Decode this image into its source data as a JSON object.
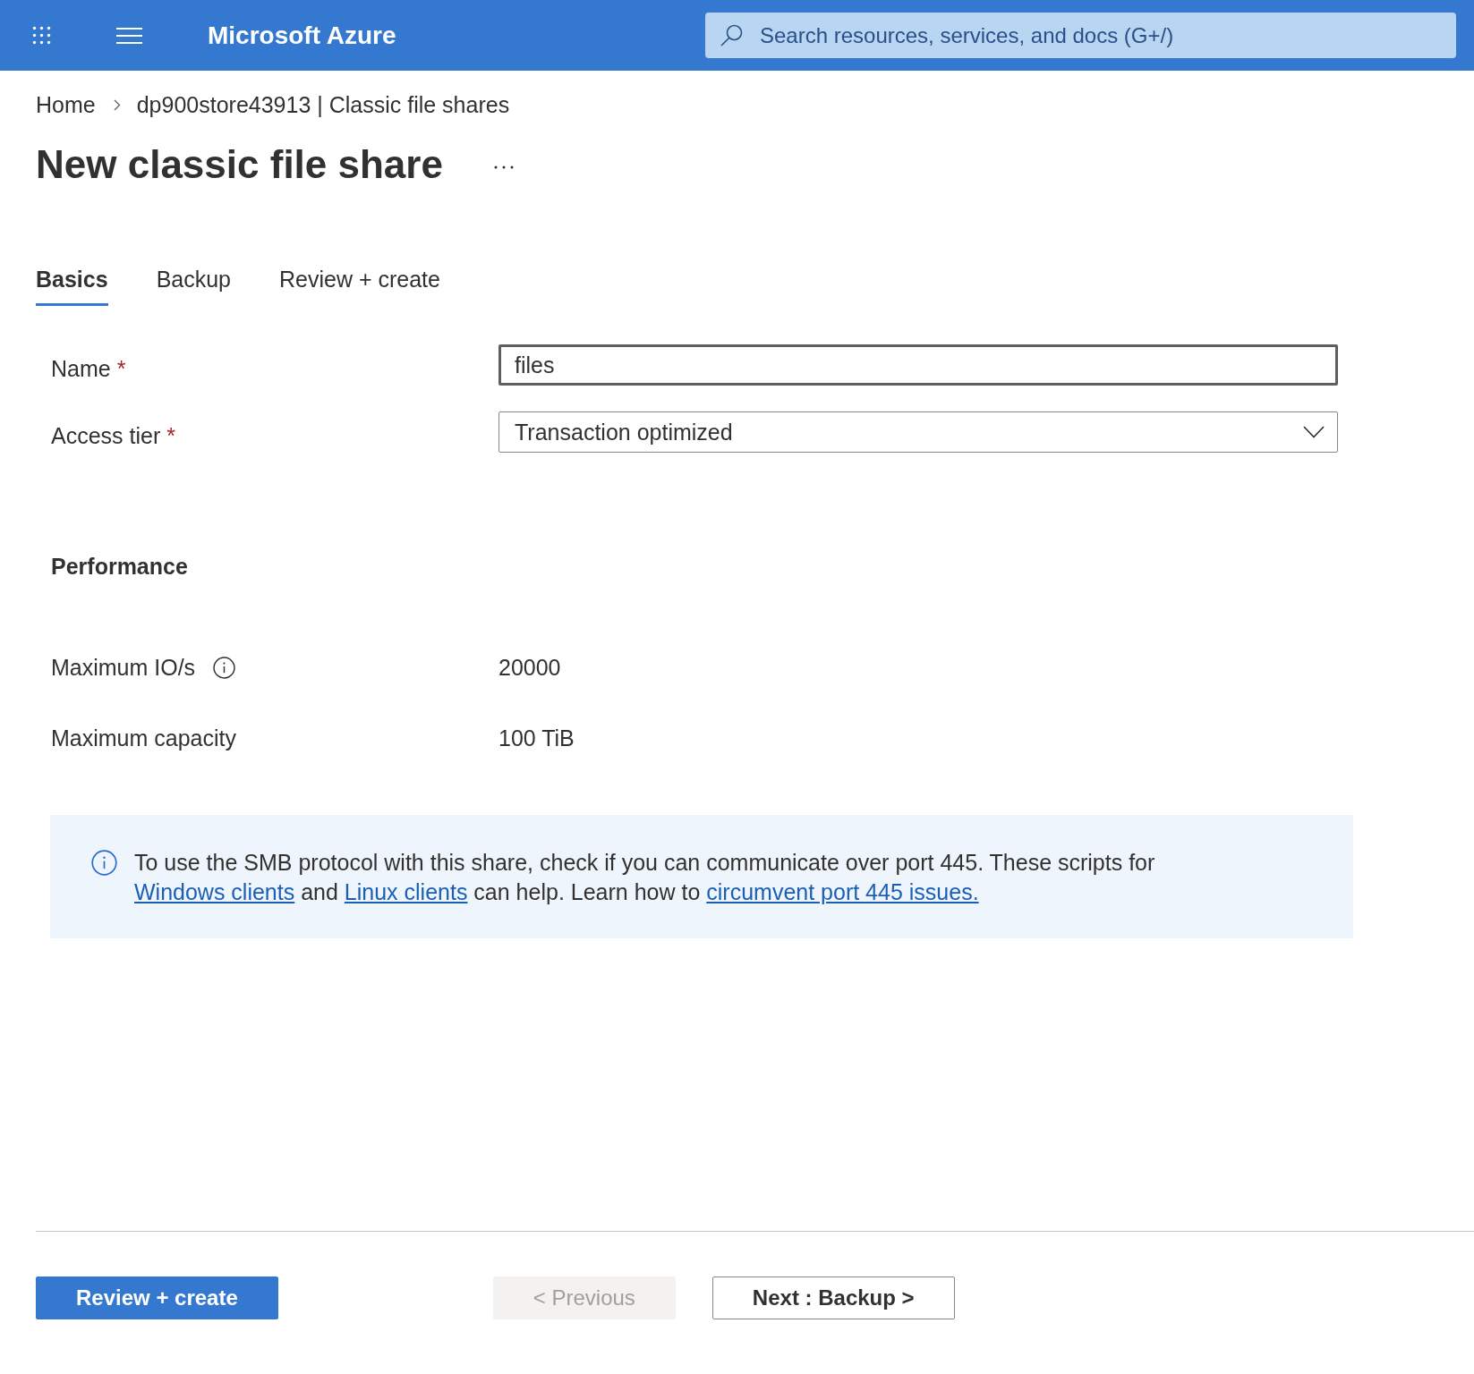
{
  "top_bar": {
    "title": "Microsoft Azure",
    "search": {
      "placeholder": "Search resources, services, and docs (G+/)"
    }
  },
  "breadcrumb": [
    {
      "label": "Home"
    },
    {
      "label": "dp900store43913 | Classic file shares"
    }
  ],
  "page_title": "New classic file share",
  "tabs": [
    {
      "label": "Basics",
      "selected": true
    },
    {
      "label": "Backup",
      "selected": false
    },
    {
      "label": "Review + create",
      "selected": false
    }
  ],
  "fields": [
    {
      "kind": "text",
      "label": "Name",
      "required_mark": "*",
      "value": "files",
      "focused": true
    },
    {
      "kind": "dropdown",
      "label": "Access tier",
      "required_mark": "*",
      "value": "Transaction optimized",
      "focused": false
    }
  ],
  "performance": {
    "heading": "Performance",
    "rows": [
      {
        "label": "Maximum IO/s",
        "info": true,
        "value": "20000"
      },
      {
        "label": "Maximum capacity",
        "info": false,
        "value": "100 TiB"
      }
    ]
  },
  "notice": {
    "parts": [
      {
        "kind": "text",
        "text": "To use the SMB protocol with this share, check if you can communicate over port 445. These scripts for "
      },
      {
        "kind": "link",
        "text": "Windows clients"
      },
      {
        "kind": "text",
        "text": " and "
      },
      {
        "kind": "link",
        "text": "Linux clients"
      },
      {
        "kind": "text",
        "text": " can help. Learn how to "
      },
      {
        "kind": "link",
        "text": "circumvent port 445 issues."
      }
    ]
  },
  "footer": {
    "buttons": [
      {
        "kind": "primary",
        "label": "Review + create",
        "disabled": false
      },
      {
        "kind": "secondary",
        "label": "< Previous",
        "disabled": true
      },
      {
        "kind": "secondary",
        "label": "Next : Backup >",
        "disabled": false
      }
    ]
  }
}
